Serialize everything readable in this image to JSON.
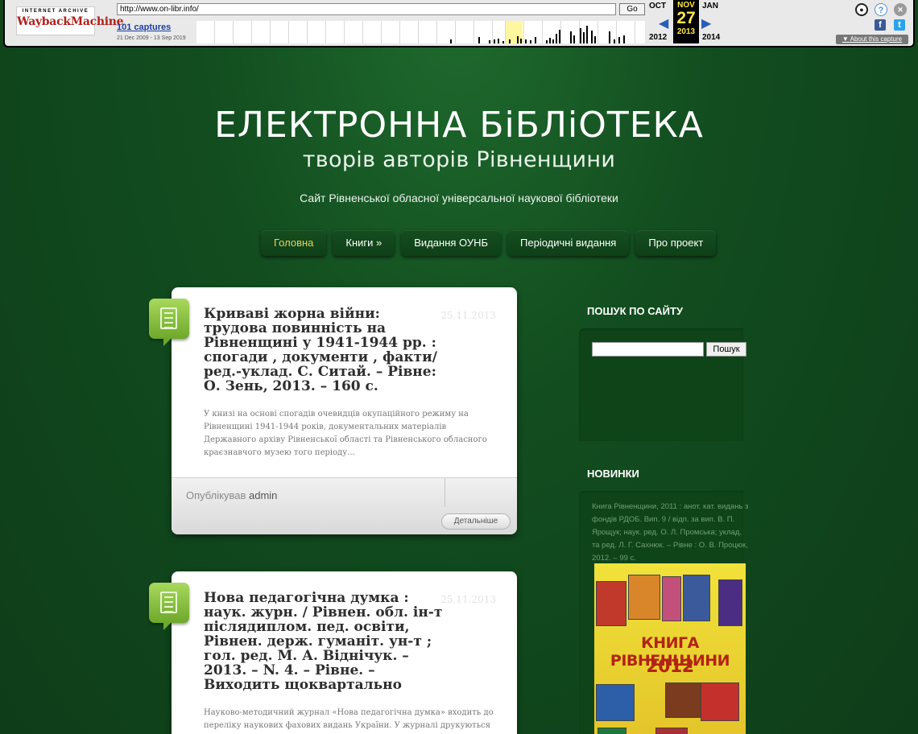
{
  "wayback": {
    "logo_top": "INTERNET ARCHIVE",
    "logo_main": "WaybackMachine",
    "url": "http://www.on-libr.info/",
    "go": "Go",
    "captures": "101 captures",
    "range": "21 Dec 2009 - 13 Sep 2019",
    "prev_month": "OCT",
    "cur_month": "NOV",
    "next_month": "JAN",
    "cur_day": "27",
    "prev_year": "2012",
    "cur_year": "2013",
    "next_year": "2014",
    "about": "About this capture",
    "facebook": "f",
    "twitter": "t",
    "help": "?",
    "close": "✕"
  },
  "header": {
    "title": "ЕЛЕКТРОННА БіБЛіОТЕКА",
    "subtitle": "творів авторів Рівненщини",
    "description": "Сайт Рівненської обласної універсальної наукової бібліотеки"
  },
  "nav": [
    {
      "label": "Головна",
      "active": true
    },
    {
      "label": "Книги »",
      "active": false
    },
    {
      "label": "Видання ОУНБ",
      "active": false
    },
    {
      "label": "Періодичні видання",
      "active": false
    },
    {
      "label": "Про проект",
      "active": false
    }
  ],
  "posts": [
    {
      "date": "25.11.2013",
      "title": "Криваві жорна війни: трудова повинність на Рівненщині у 1941-1944 рр. : спогади , документи , факти/ ред.-уклад. С. Ситай. – Рівне: О. Зень, 2013. – 160 с.",
      "excerpt": "У книзі на основі спогадів очевидців окупаційного режиму на Рівненщині 1941-1944 років, документальних матеріалів Державного архіву Рівненської області та Рівненського обласного краєзнавчого музею того періоду...",
      "author_prefix": "Опублікував",
      "author": "admin",
      "more": "Детальніше"
    },
    {
      "date": "25.11.2013",
      "title": "Нова педагогічна думка : наук. журн. / Рівнен. обл. ін-т післядиплом. пед. освіти, Рівнен. держ. гуманіт. ун-т ; гол. ред. М. А. Віднічук. – 2013. – N. 4. – Рівне. – Виходить щоквартально",
      "excerpt": "Науково-методичний журнал «Нова педагогічна думка» входить до переліку наукових фахових видань України. У журналі друкуються"
    }
  ],
  "sidebar": {
    "search_title": "ПОШУК ПО САЙТУ",
    "search_button": "Пошук",
    "search_value": "",
    "news_title": "НОВИНКИ",
    "news_text": "Книга Рівненщини, 2011 : анот. кат. видань з фондів РДОБ. Вип. 9 / відп. за вип. В. П. Ярощук; наук. ред. О. Л. Промська; уклад. та ред. Л. Г. Сахнюк. – Рівне : О. В. Процюк, 2012. – 99 с.",
    "cover_title": "КНИГА РІВНЕНЩИНИ",
    "cover_year": "2012"
  },
  "colors": {
    "background": "#124d1f",
    "nav_active": "#e6d25a",
    "badge": "#8cc63f"
  }
}
